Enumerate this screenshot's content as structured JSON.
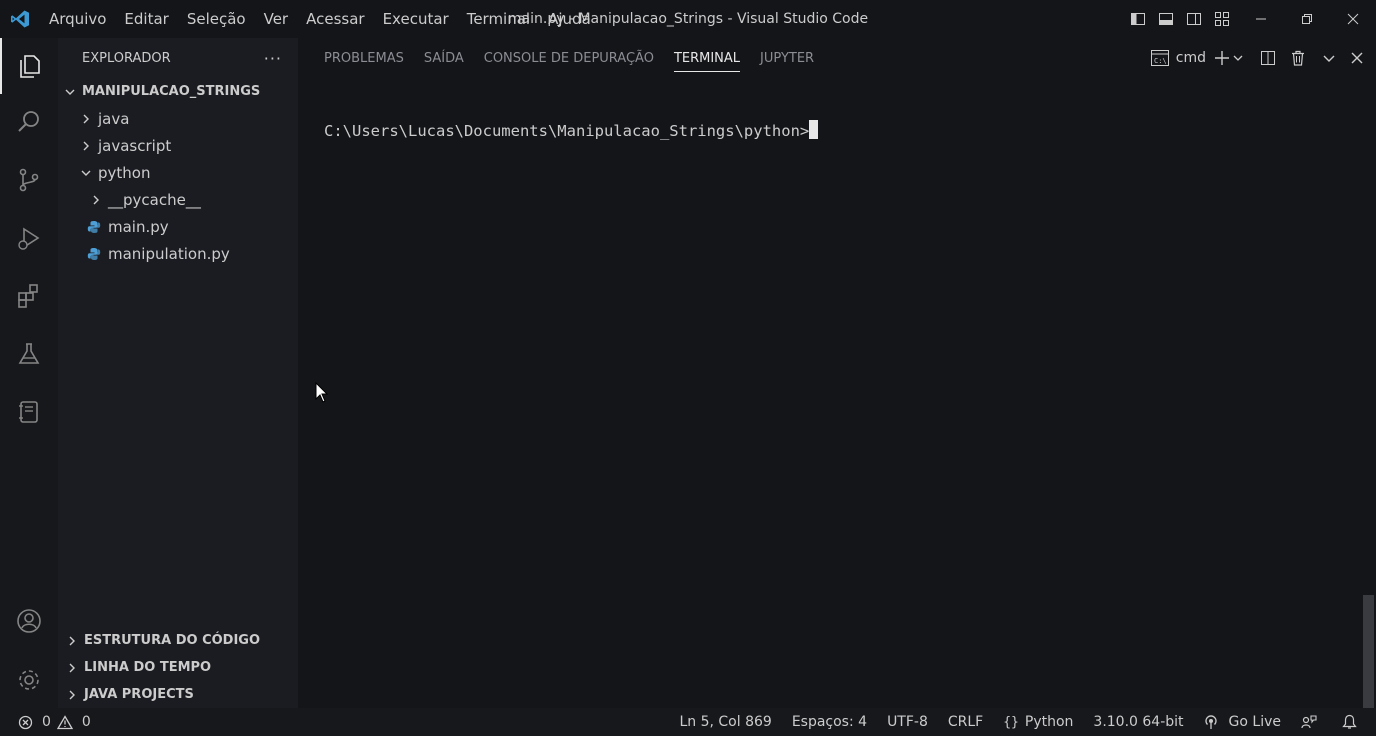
{
  "menu": [
    "Arquivo",
    "Editar",
    "Seleção",
    "Ver",
    "Acessar",
    "Executar",
    "Terminal",
    "Ajuda"
  ],
  "window_title": "main.py - Manipulacao_Strings - Visual Studio Code",
  "sidebar": {
    "title": "EXPLORADOR",
    "more": "···",
    "root": "MANIPULACAO_STRINGS",
    "tree": [
      {
        "label": "java",
        "type": "folder",
        "expanded": false
      },
      {
        "label": "javascript",
        "type": "folder",
        "expanded": false
      },
      {
        "label": "python",
        "type": "folder",
        "expanded": true
      },
      {
        "label": "__pycache__",
        "type": "folder",
        "expanded": false
      },
      {
        "label": "main.py",
        "type": "python-file"
      },
      {
        "label": "manipulation.py",
        "type": "python-file"
      }
    ],
    "sections": [
      "ESTRUTURA DO CÓDIGO",
      "LINHA DO TEMPO",
      "JAVA PROJECTS"
    ]
  },
  "panel": {
    "tabs": [
      "PROBLEMAS",
      "SAÍDA",
      "CONSOLE DE DEPURAÇÃO",
      "TERMINAL",
      "JUPYTER"
    ],
    "active_tab": "TERMINAL",
    "shell_name": "cmd",
    "terminal_prompt": "C:\\Users\\Lucas\\Documents\\Manipulacao_Strings\\python>"
  },
  "status": {
    "errors": "0",
    "warnings": "0",
    "position": "Ln 5, Col 869",
    "spaces": "Espaços: 4",
    "encoding": "UTF-8",
    "eol": "CRLF",
    "language": "Python",
    "interpreter": "3.10.0 64-bit",
    "golive": "Go Live"
  },
  "colors": {
    "vscode_blue": "#3c99d4",
    "python_blue": "#4d9fd6",
    "active_tab_underline": "#e7e7e7"
  }
}
